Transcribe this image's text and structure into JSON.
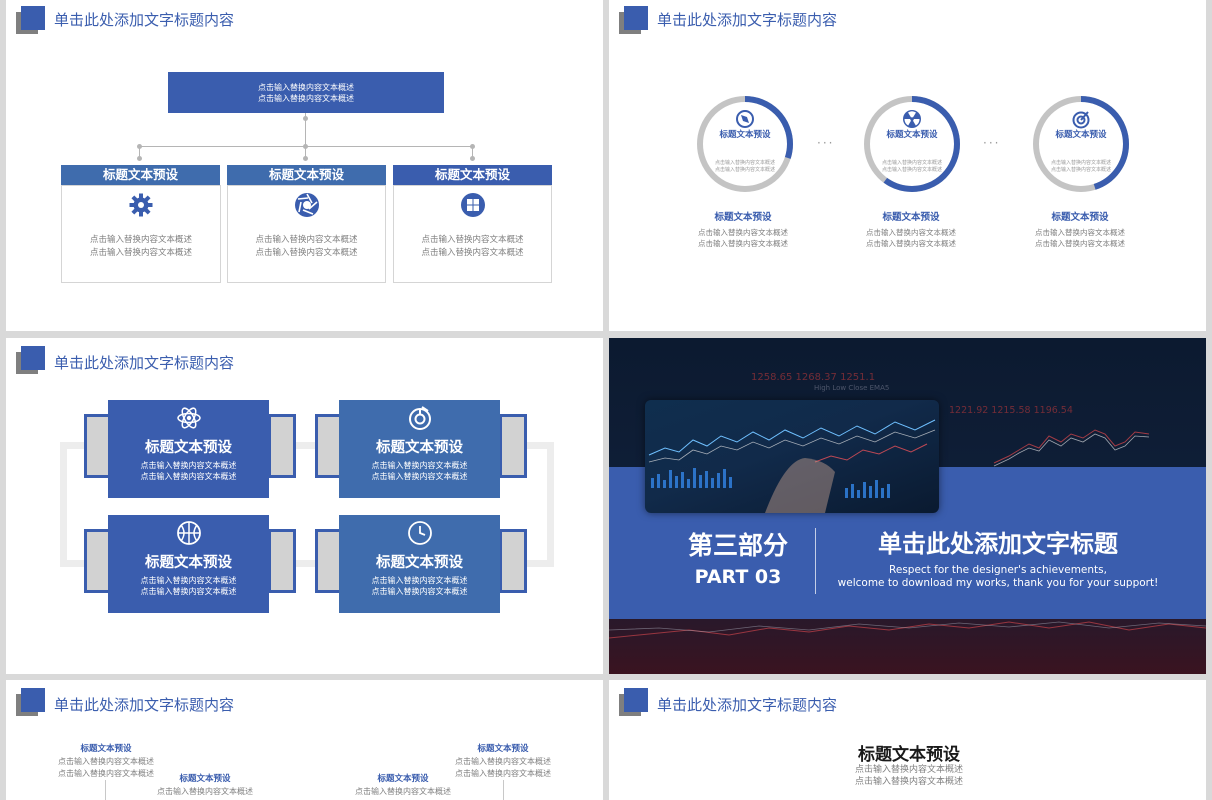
{
  "header_title": "单击此处添加文字标题内容",
  "title_placeholder": "标题文本预设",
  "body_placeholder": "点击输入替换内容文本概述",
  "colors": {
    "accent": "#3a5dae",
    "accent_alt": "#3f6cad",
    "gray": "#808080",
    "ring_gray": "#c4c4c4"
  },
  "slide1": {
    "top_box_lines": [
      "点击输入替换内容文本概述",
      "点击输入替换内容文本概述"
    ],
    "cards": [
      {
        "title": "标题文本预设",
        "icon": "gear-icon",
        "lines": [
          "点击输入替换内容文本概述",
          "点击输入替换内容文本概述"
        ]
      },
      {
        "title": "标题文本预设",
        "icon": "aperture-icon",
        "lines": [
          "点击输入替换内容文本概述",
          "点击输入替换内容文本概述"
        ]
      },
      {
        "title": "标题文本预设",
        "icon": "windows-icon",
        "lines": [
          "点击输入替换内容文本概述",
          "点击输入替换内容文本概述"
        ]
      }
    ]
  },
  "slide2": {
    "separator": "···",
    "rings": [
      {
        "title": "标题文本预设",
        "icon": "compass-icon",
        "progress": 0.3,
        "inner_lines": [
          "点击输入替换内容文本概述",
          "点击输入替换内容文本概述"
        ],
        "below_title": "标题文本预设",
        "below_lines": [
          "点击输入替换内容文本概述",
          "点击输入替换内容文本概述"
        ]
      },
      {
        "title": "标题文本预设",
        "icon": "radiation-icon",
        "progress": 0.6,
        "inner_lines": [
          "点击输入替换内容文本概述",
          "点击输入替换内容文本概述"
        ],
        "below_title": "标题文本预设",
        "below_lines": [
          "点击输入替换内容文本概述",
          "点击输入替换内容文本概述"
        ]
      },
      {
        "title": "标题文本预设",
        "icon": "target-icon",
        "progress": 0.45,
        "inner_lines": [
          "点击输入替换内容文本概述",
          "点击输入替换内容文本概述"
        ],
        "below_title": "标题文本预设",
        "below_lines": [
          "点击输入替换内容文本概述",
          "点击输入替换内容文本概述"
        ]
      }
    ]
  },
  "slide3": {
    "tiles": [
      {
        "title": "标题文本预设",
        "icon": "atom-icon",
        "lines": [
          "点击输入替换内容文本概述",
          "点击输入替换内容文本概述"
        ]
      },
      {
        "title": "标题文本预设",
        "icon": "chart-donut-icon",
        "lines": [
          "点击输入替换内容文本概述",
          "点击输入替换内容文本概述"
        ]
      },
      {
        "title": "标题文本预设",
        "icon": "basketball-icon",
        "lines": [
          "点击输入替换内容文本概述",
          "点击输入替换内容文本概述"
        ]
      },
      {
        "title": "标题文本预设",
        "icon": "clock-icon",
        "lines": [
          "点击输入替换内容文本概述",
          "点击输入替换内容文本概述"
        ]
      }
    ]
  },
  "slide4": {
    "part_cn": "第三部分",
    "part_en": "PART 03",
    "title": "单击此处添加文字标题",
    "subtitle_lines": [
      "Respect for the designer's achievements,",
      "welcome to download my works, thank you for your support!"
    ],
    "ticker_top": "1258.65  1268.37  1251.1",
    "ticker_labels": "High    Low    Close    EMA5",
    "ticker_mid": "1221.92  1215.58  1196.54"
  },
  "slide5": {
    "items": [
      {
        "title": "标题文本预设",
        "lines": [
          "点击输入替换内容文本概述",
          "点击输入替换内容文本概述"
        ]
      },
      {
        "title": "标题文本预设",
        "lines": [
          "点击输入替换内容文本概述"
        ]
      },
      {
        "title": "标题文本预设",
        "lines": [
          "点击输入替换内容文本概述"
        ]
      },
      {
        "title": "标题文本预设",
        "lines": [
          "点击输入替换内容文本概述",
          "点击输入替换内容文本概述"
        ]
      }
    ]
  },
  "slide6": {
    "title": "标题文本预设",
    "lines": [
      "点击输入替换内容文本概述",
      "点击输入替换内容文本概述"
    ]
  }
}
